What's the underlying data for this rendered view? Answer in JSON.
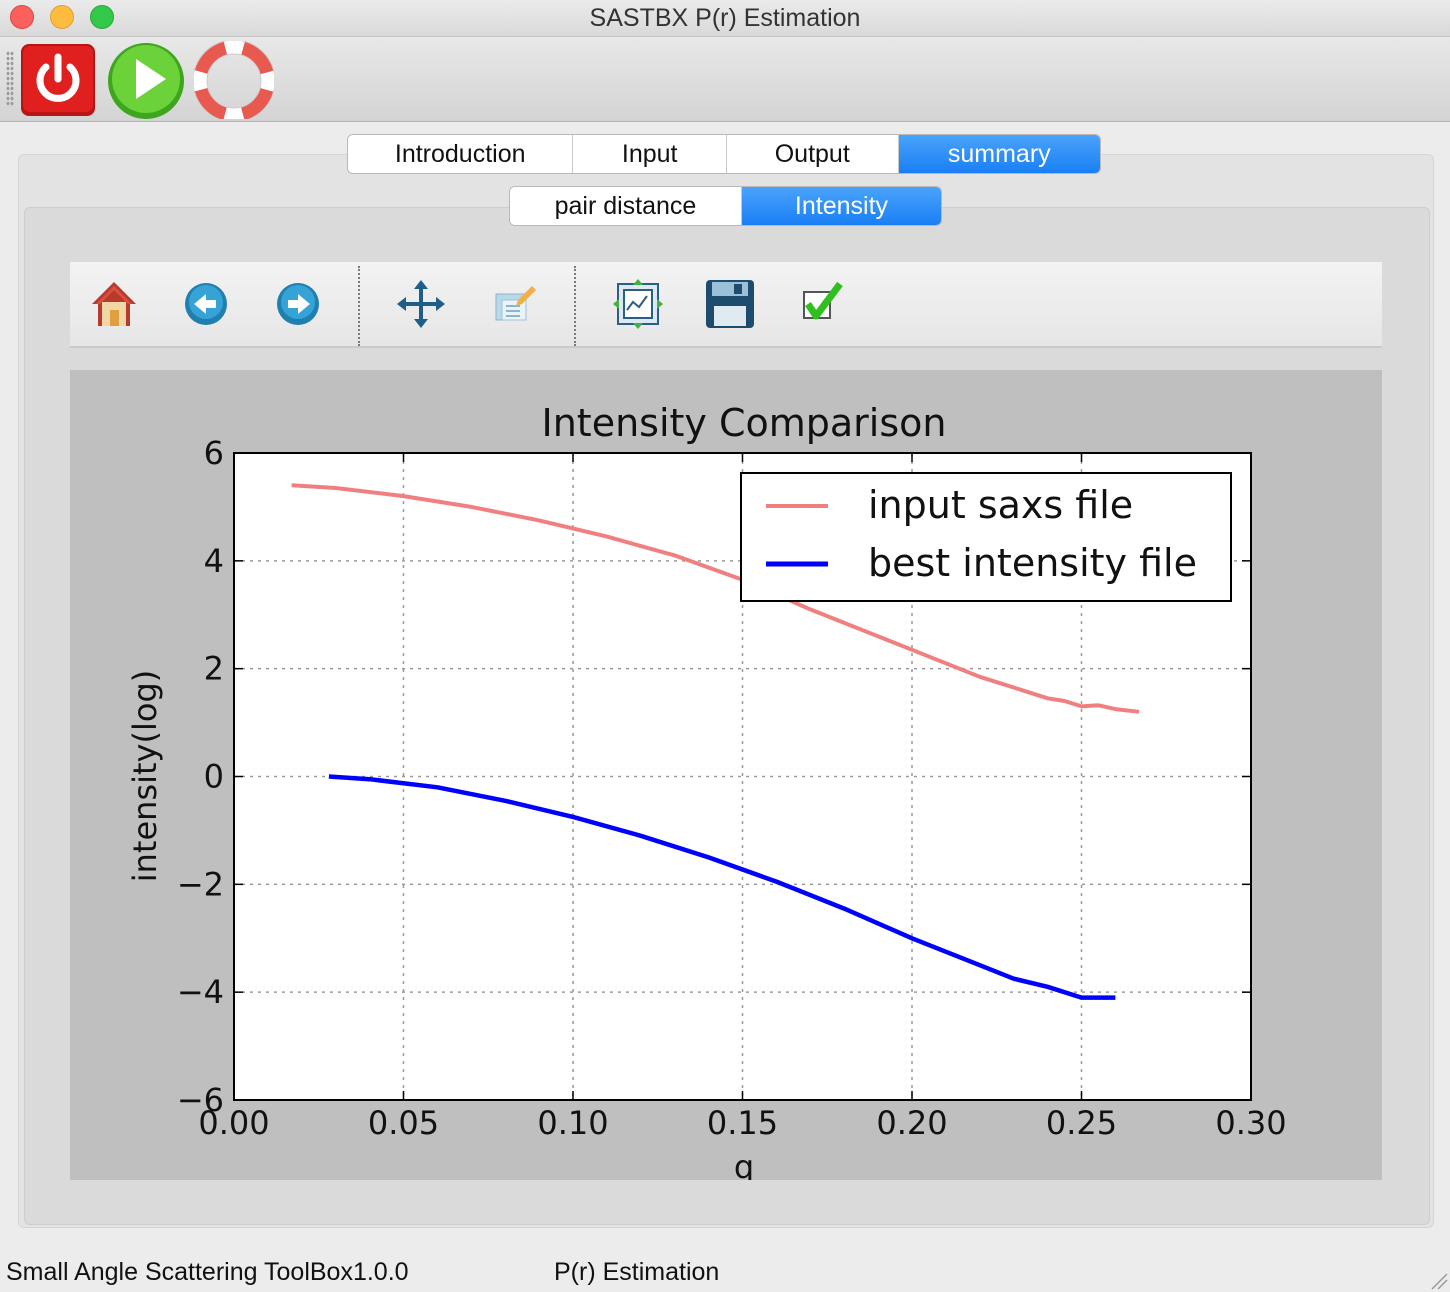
{
  "window": {
    "title": "SASTBX P(r) Estimation"
  },
  "toolbar": {
    "icons": [
      "power-icon",
      "play-icon",
      "lifebuoy-icon"
    ]
  },
  "tabs": [
    "Introduction",
    "Input",
    "Output",
    "summary"
  ],
  "active_tab": "summary",
  "subtabs": [
    "pair distance",
    "Intensity"
  ],
  "active_subtab": "Intensity",
  "plot_toolbar": {
    "icons": [
      "home-icon",
      "back-icon",
      "forward-icon",
      "pan-icon",
      "zoom-icon",
      "subplots-icon",
      "save-icon",
      "check-icon"
    ]
  },
  "chart_data": {
    "type": "line",
    "title": "Intensity Comparison",
    "xlabel": "q",
    "ylabel": "intensity(log)",
    "xlim": [
      0.0,
      0.3
    ],
    "ylim": [
      -6,
      6
    ],
    "xticks": [
      "0.00",
      "0.05",
      "0.10",
      "0.15",
      "0.20",
      "0.25",
      "0.30"
    ],
    "yticks": [
      "6",
      "4",
      "2",
      "0",
      "−2",
      "−4",
      "−6"
    ],
    "grid": true,
    "legend_position": "upper right",
    "series": [
      {
        "name": "input saxs file",
        "color": "#f08080",
        "x": [
          0.017,
          0.03,
          0.05,
          0.07,
          0.09,
          0.11,
          0.13,
          0.15,
          0.17,
          0.19,
          0.2,
          0.21,
          0.22,
          0.23,
          0.24,
          0.245,
          0.25,
          0.255,
          0.26,
          0.267
        ],
        "y": [
          5.4,
          5.35,
          5.2,
          5.0,
          4.75,
          4.45,
          4.1,
          3.65,
          3.1,
          2.6,
          2.35,
          2.1,
          1.85,
          1.65,
          1.45,
          1.4,
          1.3,
          1.32,
          1.25,
          1.2
        ]
      },
      {
        "name": "best intensity file",
        "color": "#0000ff",
        "x": [
          0.028,
          0.04,
          0.06,
          0.08,
          0.1,
          0.12,
          0.14,
          0.16,
          0.18,
          0.2,
          0.22,
          0.23,
          0.24,
          0.25,
          0.26
        ],
        "y": [
          0.0,
          -0.05,
          -0.2,
          -0.45,
          -0.75,
          -1.1,
          -1.5,
          -1.95,
          -2.45,
          -3.0,
          -3.5,
          -3.75,
          -3.9,
          -4.1,
          -4.1
        ]
      }
    ]
  },
  "status": {
    "left": "Small Angle Scattering ToolBox1.0.0",
    "right": "P(r) Estimation"
  }
}
